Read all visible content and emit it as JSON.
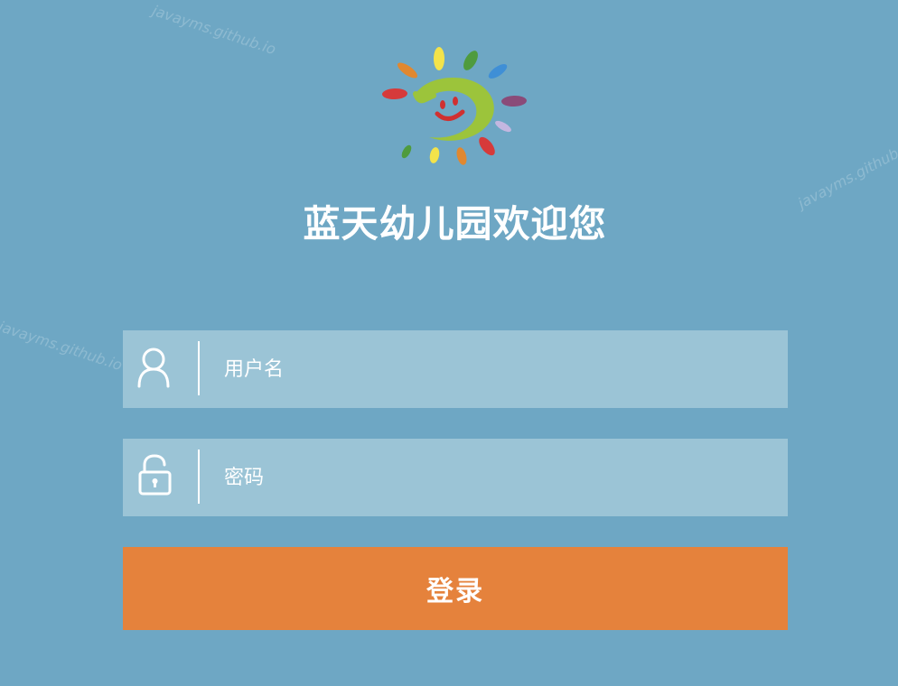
{
  "watermark": {
    "text": "javayms.github.io"
  },
  "logo": {
    "icon": "sun-smiley-logo"
  },
  "page": {
    "title": "蓝天幼儿园欢迎您"
  },
  "form": {
    "username_placeholder": "用户名",
    "username_value": "",
    "password_placeholder": "密码",
    "password_value": "",
    "login_label": "登录"
  },
  "colors": {
    "background": "#6ea7c4",
    "field_background": "#9bc4d6",
    "button": "#e5823c",
    "text": "#ffffff"
  }
}
